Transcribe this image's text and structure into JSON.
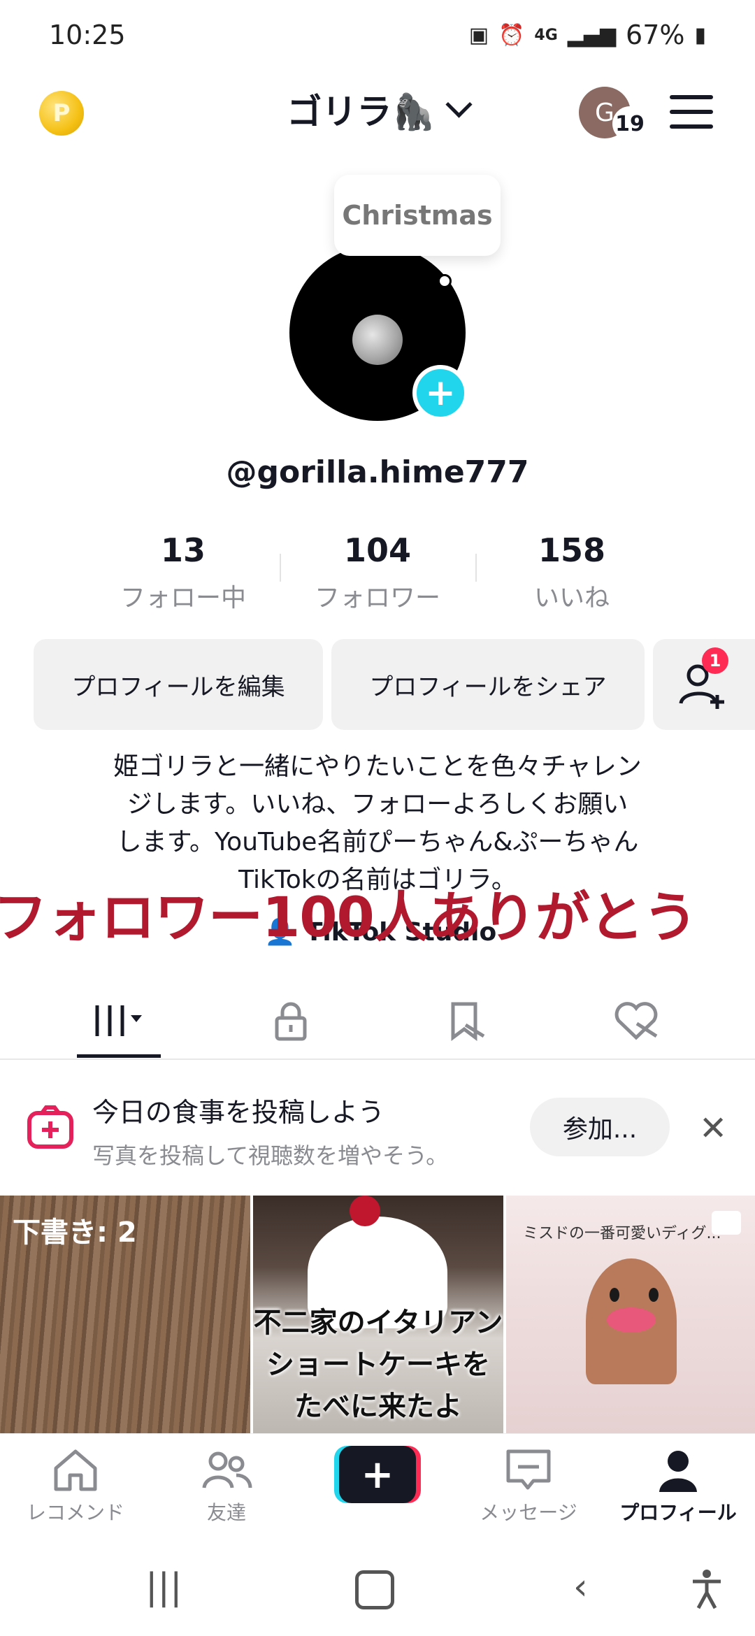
{
  "status_bar": {
    "time": "10:25",
    "network": "4G",
    "battery": "67%"
  },
  "header": {
    "title": "ゴリラ🦍",
    "avatar_letter": "G",
    "avatar_badge": "19"
  },
  "profile": {
    "bubble_text": "Christmas",
    "username": "@gorilla.hime777",
    "stats": [
      {
        "value": "13",
        "label": "フォロー中"
      },
      {
        "value": "104",
        "label": "フォロワー"
      },
      {
        "value": "158",
        "label": "いいね"
      }
    ],
    "edit_button": "プロフィールを編集",
    "share_button": "プロフィールをシェア",
    "add_friend_badge": "1",
    "bio_lines": [
      "姫ゴリラと一緒にやりたいことを色々チャレン",
      "ジします。いいね、フォローよろしくお願い",
      "します。YouTube名前ぴーちゃん&ぷーちゃん",
      "TikTokの名前はゴリラ。"
    ],
    "overlay_text": "フォロワー100人ありがとう",
    "studio_link": "TikTok Studio"
  },
  "banner": {
    "title": "今日の食事を投稿しよう",
    "subtitle": "写真を投稿して視聴数を増やそう。",
    "button": "参加..."
  },
  "grid": {
    "draft_label": "下書き: 2",
    "tile2_lines": [
      "不二家のイタリアン",
      "ショートケーキを",
      "たべに来たよ"
    ],
    "tile3_caption": "ミスドの一番可愛いディグ..."
  },
  "bottom_nav": [
    {
      "label": "レコメンド",
      "icon": "home-icon"
    },
    {
      "label": "友達",
      "icon": "friends-icon"
    },
    {
      "label": "メッセージ",
      "icon": "message-icon"
    },
    {
      "label": "プロフィール",
      "icon": "profile-icon"
    }
  ],
  "colors": {
    "accent_cyan": "#20d5ec",
    "accent_red": "#fe2c55",
    "overlay_red": "#b11a2e"
  }
}
